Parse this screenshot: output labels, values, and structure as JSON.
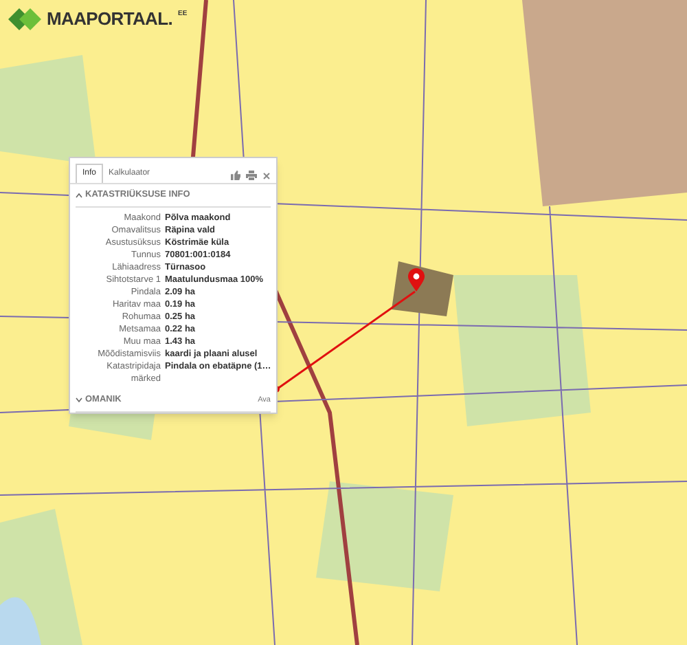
{
  "logo": {
    "name": "MAAPORTAAL.",
    "suffix": "EE"
  },
  "popup": {
    "tabs": [
      {
        "label": "Info",
        "selected": true
      },
      {
        "label": "Kalkulaator",
        "selected": false
      }
    ],
    "sections": [
      {
        "title": "KATASTRIÜKSUSE INFO",
        "expanded": true,
        "rows": [
          {
            "label": "Maakond",
            "value": "Põlva maakond"
          },
          {
            "label": "Omavalitsus",
            "value": "Räpina vald"
          },
          {
            "label": "Asustusüksus",
            "value": "Köstrimäe küla"
          },
          {
            "label": "Tunnus",
            "value": "70801:001:0184"
          },
          {
            "label": "Lähiaadress",
            "value": "Türnasoo"
          },
          {
            "label": "Sihtotstarve 1",
            "value": "Maatulundusmaa 100%"
          },
          {
            "label": "Pindala",
            "value": "2.09 ha"
          },
          {
            "label": "Haritav maa",
            "value": "0.19 ha"
          },
          {
            "label": "Rohumaa",
            "value": "0.25 ha"
          },
          {
            "label": "Metsamaa",
            "value": "0.22 ha"
          },
          {
            "label": "Muu maa",
            "value": "1.43 ha"
          },
          {
            "label": "Mõõdistamisviis",
            "value": "kaardi ja plaani alusel"
          },
          {
            "label": "Katastripidaja märked",
            "value": "Pindala on ebatäpne (1…"
          }
        ]
      },
      {
        "title": "OMANIK",
        "expanded": false,
        "action": "Ava"
      }
    ]
  }
}
